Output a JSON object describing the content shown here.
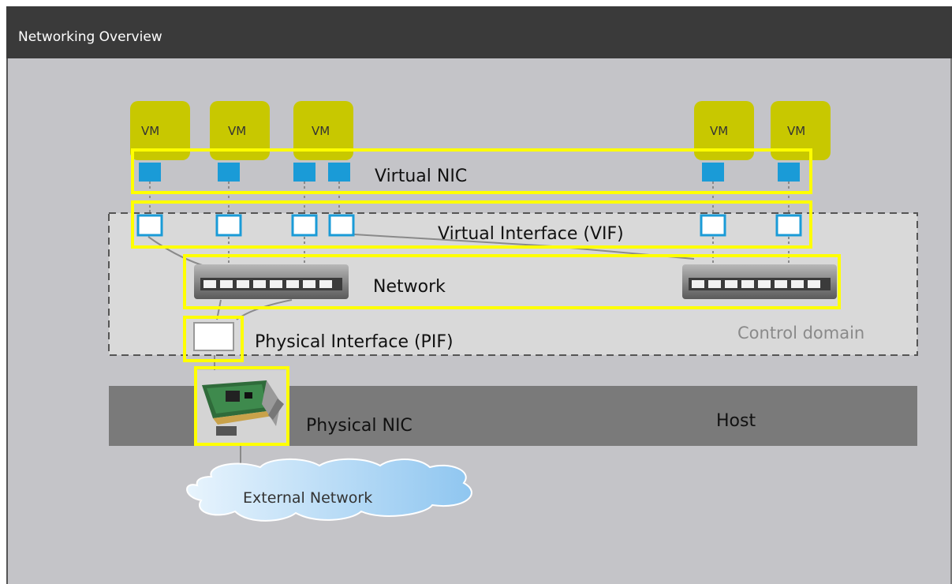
{
  "window": {
    "title": "Networking Overview"
  },
  "vms": [
    {
      "label": "VM"
    },
    {
      "label": "VM"
    },
    {
      "label": "VM"
    },
    {
      "label": "VM"
    },
    {
      "label": "VM"
    }
  ],
  "labels": {
    "virtual_nic": "Virtual NIC",
    "vif": "Virtual Interface (VIF)",
    "network": "Network",
    "pif": "Physical Interface (PIF)",
    "control_domain": "Control domain",
    "physical_nic": "Physical NIC",
    "host": "Host",
    "external_network": "External Network"
  },
  "colors": {
    "vm_fill": "#c8c800",
    "nic_fill": "#1a9bd7",
    "highlight": "#ffff00",
    "host_band": "#7a7a7a",
    "control_domain_fill": "#d9d9d9",
    "cloud": "#9fd0f5"
  },
  "icons": {
    "switch": "network-switch-icon",
    "nic_card": "network-card-icon",
    "cloud": "cloud-icon"
  }
}
